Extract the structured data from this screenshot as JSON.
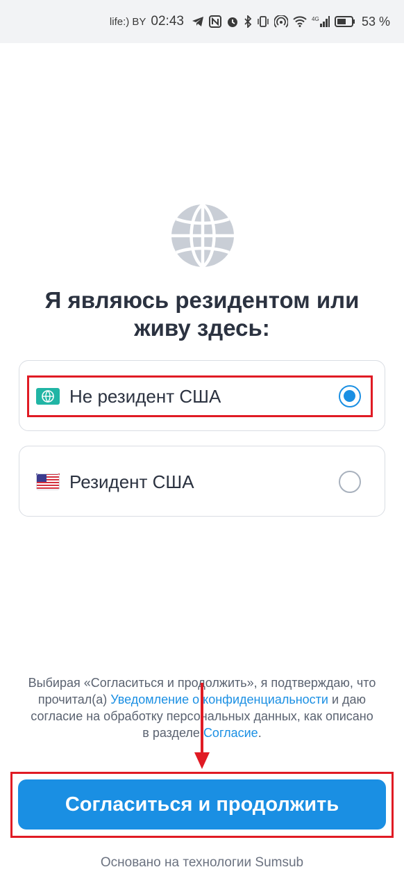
{
  "status_bar": {
    "carrier": "life:) BY",
    "time": "02:43",
    "battery_percent": "53 %",
    "icons": [
      "telegram-icon",
      "nfc-icon",
      "alarm-icon",
      "bluetooth-icon",
      "vibrate-icon",
      "hotspot-icon",
      "wifi-icon",
      "signal-4g-icon",
      "battery-icon"
    ]
  },
  "main": {
    "illustration": "globe-icon",
    "title": "Я являюсь резидентом или живу здесь:",
    "options": [
      {
        "label": "Не резидент США",
        "icon": "globe-badge-icon",
        "selected": true
      },
      {
        "label": "Резидент США",
        "icon": "us-flag-icon",
        "selected": false
      }
    ]
  },
  "consent": {
    "text_1": "Выбирая «Согласиться и продолжить», я подтверждаю, что прочитал(а) ",
    "link_privacy": "Уведомление о конфиденциальности",
    "text_2": " и даю согласие на обработку персональных данных, как описано в разделе ",
    "link_consent": "Согласие",
    "text_3": "."
  },
  "primary_button": {
    "label": "Согласиться и продолжить"
  },
  "footer": {
    "text": "Основано на технологии Sumsub"
  },
  "colors": {
    "accent": "#1a8fe3",
    "annotation": "#e01b24",
    "text": "#2b3240"
  }
}
